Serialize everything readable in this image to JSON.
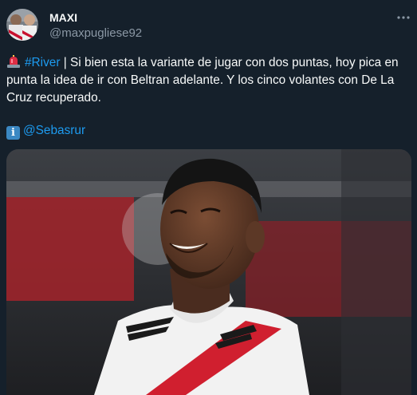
{
  "author": {
    "display_name": "MAXI",
    "handle": "@maxpugliese92"
  },
  "tweet": {
    "hashtag": "#River",
    "separator": " | ",
    "text": " Si bien esta la variante de jugar con dos puntas, hoy pica en punta la idea de ir con Beltran adelante. Y los cinco volantes con De La Cruz recuperado.",
    "mention": "@Sebasrur"
  },
  "icons": {
    "siren": "police-car-light-icon",
    "info": "information-icon",
    "more": "more-options-icon"
  }
}
